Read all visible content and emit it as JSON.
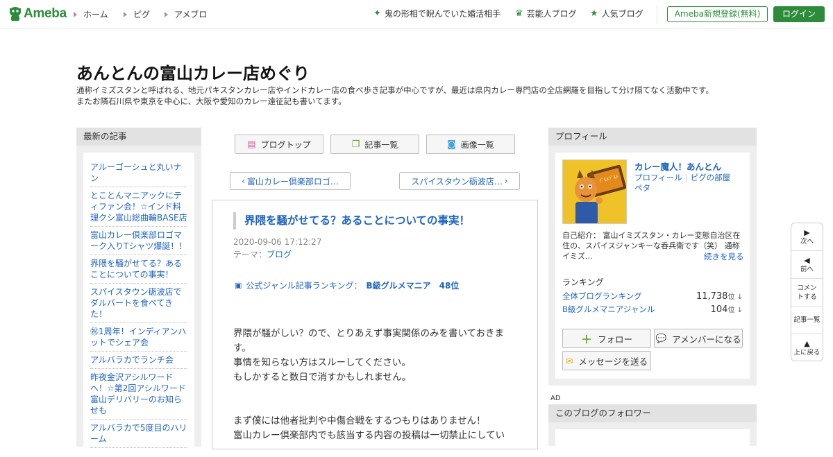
{
  "header": {
    "logo": "Ameba",
    "nav": [
      "ホーム",
      "ピグ",
      "アメブロ"
    ],
    "right_links": [
      {
        "label": "鬼の形相で睨んでいた婚活相手",
        "icon": "sparkle-icon"
      },
      {
        "label": "芸能人ブログ",
        "icon": "crown-icon"
      },
      {
        "label": "人気ブログ",
        "icon": "star-icon"
      }
    ],
    "register_label": "Ameba新規登録(無料)",
    "login_label": "ログイン"
  },
  "blog": {
    "title": "あんとんの富山カレー店めぐり",
    "description_line1": "通称イミズスタンと呼ばれる、地元パキスタンカレー店やインドカレー店の食べ歩き記事が中心ですが、最近は県内カレー専門店の全店網羅を目指して分け隔てなく活動中です。",
    "description_line2": "またお隣石川県や東京を中心に、大阪や愛知のカレー遠征記も書いてます。"
  },
  "recent": {
    "heading": "最新の記事",
    "items": [
      "アルーゴーシュと丸いナン",
      "とことんマニアックにティファン会！☆インド料理クシ富山総曲輪BASE店",
      "富山カレー倶楽部ロゴマーク入りTシャツ爆誕！！",
      "界隈を騒がせてる？あることについての事実！",
      "スパイスタウン砺波店でダルバートを食べてきた！",
      "㊗1周年！インディアンハットでシェア会",
      "アルバラカでランチ会",
      "昨夜金沢アシルワードへ！☆第2回アシルワード富山デリバリーのお知らせも",
      "アルバラカで5度目のハリーム"
    ]
  },
  "toolbar": {
    "blog_top": "ブログトップ",
    "article_list": "記事一覧",
    "image_list": "画像一覧"
  },
  "pager": {
    "prev": "富山カレー倶楽部ロゴ…",
    "next": "スパイスタウン砺波店…"
  },
  "article": {
    "title": "界隈を騒がせてる？あることについての事実！",
    "date": "2020-09-06 17:12:27",
    "theme_label": "テーマ：",
    "theme": "ブログ",
    "ranking_label": "公式ジャンル記事ランキング：",
    "ranking_value": "B級グルメマニア　48位",
    "para1_l1": "界隈が騒がしい？ので、とりあえず事実関係のみを書いておきま",
    "para1_l2": "す。",
    "para1_l3": "事情を知らない方はスルーしてください。",
    "para1_l4": "もしかすると数日で消すかもしれません。",
    "para2_l1": "まず僕には他者批判や中傷合戦をするつもりはありません！",
    "para2_l2": "富山カレー倶楽部内でも該当する内容の投稿は一切禁止にしてい"
  },
  "profile": {
    "heading": "プロフィール",
    "name": "カレー魔人！あんとん",
    "link_profile": "プロフィール",
    "link_pig": "ピグの部屋",
    "link_peta": "ペタ",
    "intro": "自己紹介： 富山イミズスタン・カレー変態自治区在住の、スパイスジャンキーな呑兵衛です（笑） 通称イミズ...",
    "more": "続きを見る",
    "ranking_heading": "ランキング",
    "rank_all_label": "全体ブログランキング",
    "rank_all_value": "11,738",
    "rank_genre_label": "B級グルメマニアジャンル",
    "rank_genre_value": "104",
    "rank_unit": "位 ↓",
    "follow": "フォロー",
    "amember": "アメンバーになる",
    "message": "メッセージを送る",
    "avatar_sign": "ｸﾞﾙﾒｸﾞﾙﾒ"
  },
  "ad_label": "AD",
  "followers_heading": "このブログのフォロワー",
  "floatnav": {
    "next": "次へ",
    "prev": "前へ",
    "comment": "コメントする",
    "list": "記事一覧",
    "top": "上に戻る"
  },
  "colors": {
    "brand": "#2d8c3c",
    "link": "#1d63c2"
  }
}
